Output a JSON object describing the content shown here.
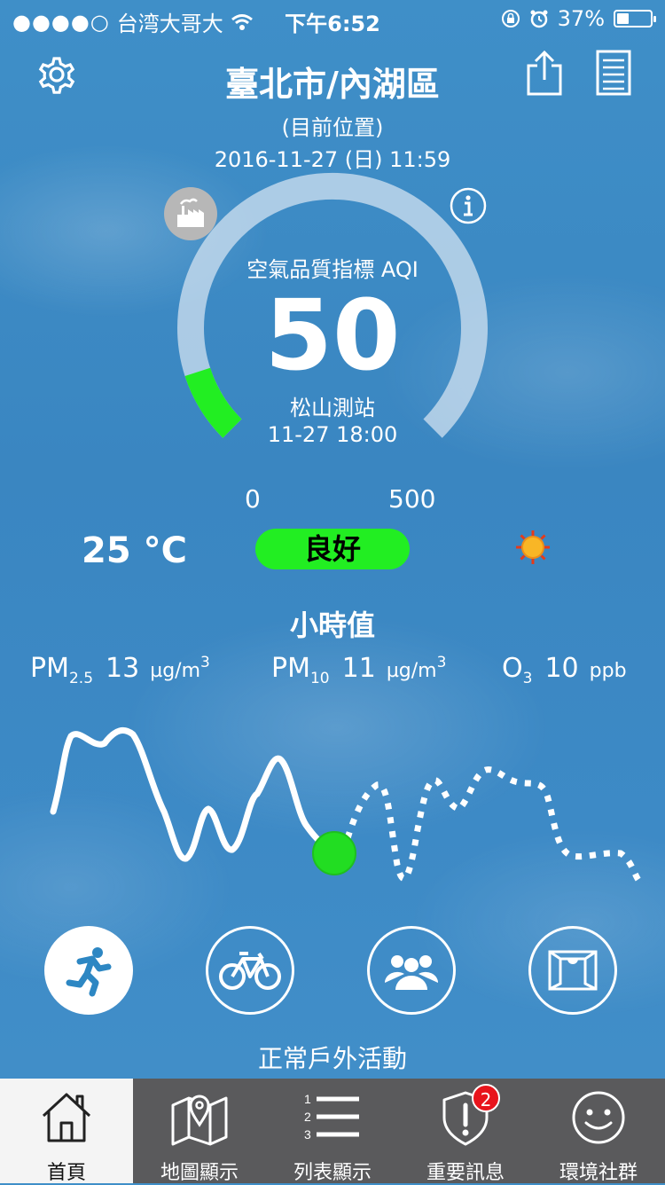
{
  "status_bar": {
    "carrier": "台湾大哥大",
    "time": "下午6:52",
    "battery": "37%",
    "battery_fraction": 0.37
  },
  "header": {
    "location": "臺北市/內湖區",
    "location_note": "(目前位置)",
    "datetime": "2016-11-27 (日) 11:59"
  },
  "gauge": {
    "title": "空氣品質指標 AQI",
    "value": "50",
    "value_fraction": 0.1,
    "station": "松山測站",
    "station_time": "11-27 18:00",
    "scale_min": "0",
    "scale_max": "500",
    "accent": "#22ee22"
  },
  "weather": {
    "temperature": "25 °C",
    "status": "良好"
  },
  "hourly": {
    "title": "小時值",
    "pm25": {
      "label": "PM",
      "sub": "2.5",
      "value": "13",
      "unit": "µg/m",
      "unit_sup": "3"
    },
    "pm10": {
      "label": "PM",
      "sub": "10",
      "value": "11",
      "unit": "µg/m",
      "unit_sup": "3"
    },
    "o3": {
      "label": "O",
      "sub": "3",
      "value": "10",
      "unit": "ppb"
    }
  },
  "activities": {
    "items": [
      {
        "icon": "runner-icon",
        "active": true
      },
      {
        "icon": "bicycle-icon",
        "active": false
      },
      {
        "icon": "group-icon",
        "active": false
      },
      {
        "icon": "window-icon",
        "active": false
      }
    ],
    "label": "正常戶外活動"
  },
  "tabbar": {
    "tabs": [
      {
        "label": "首頁",
        "icon": "home-icon"
      },
      {
        "label": "地圖顯示",
        "icon": "map-icon"
      },
      {
        "label": "列表顯示",
        "icon": "list-icon"
      },
      {
        "label": "重要訊息",
        "icon": "alert-shield-icon",
        "badge": "2"
      },
      {
        "label": "環境社群",
        "icon": "smiley-icon"
      }
    ]
  }
}
